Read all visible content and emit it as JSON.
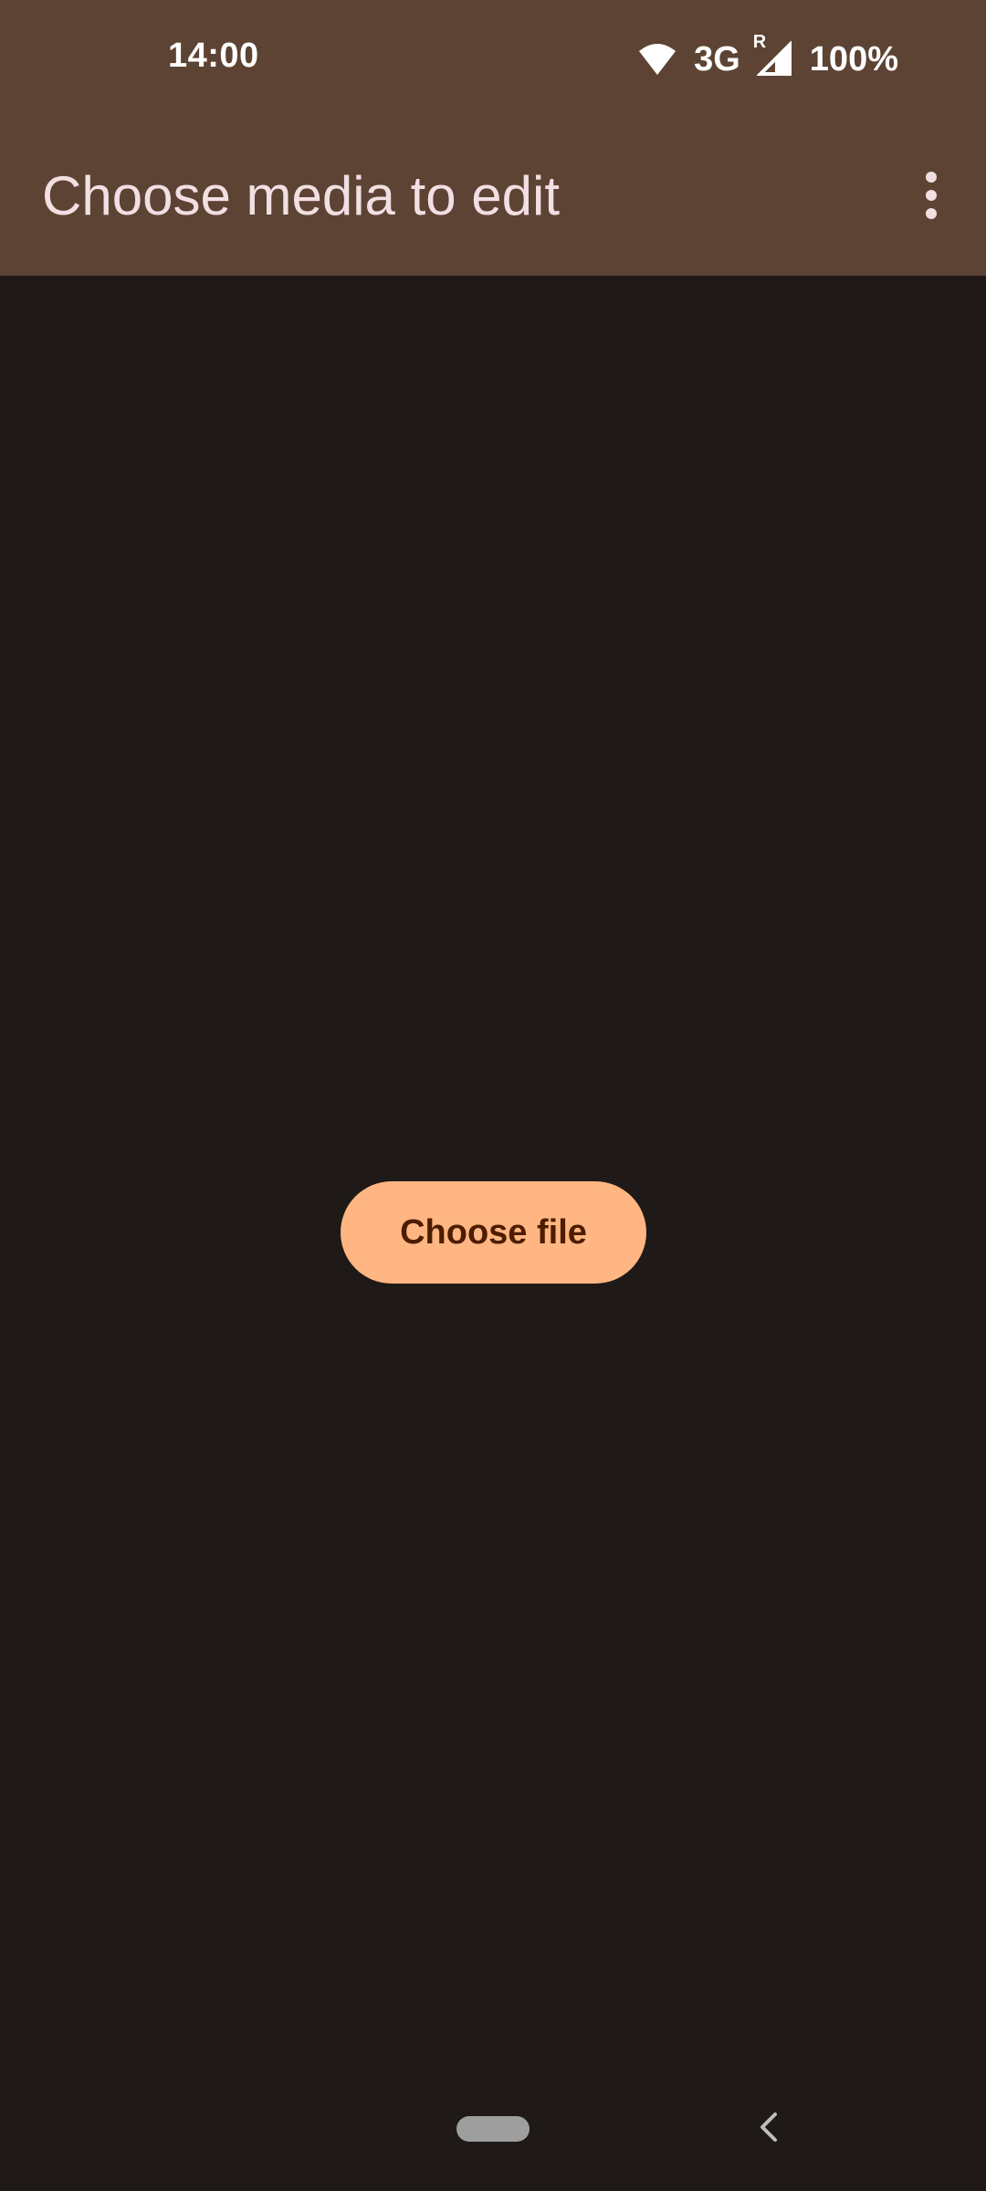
{
  "status_bar": {
    "time": "14:00",
    "network": "3G",
    "roaming": "R",
    "battery": "100%",
    "icons": [
      "wifi-icon",
      "signal-icon"
    ]
  },
  "app_bar": {
    "title": "Choose media to edit",
    "menu_icon": "more-vert-icon"
  },
  "main": {
    "choose_button_label": "Choose file"
  },
  "nav_bar": {
    "home": "home-pill",
    "back_icon": "chevron-left-icon"
  },
  "colors": {
    "app_bar": "#5d4333",
    "background": "#1f1a17",
    "title_text": "#f1dfe2",
    "button_bg": "#ffb682",
    "button_text": "#4d1d00"
  }
}
